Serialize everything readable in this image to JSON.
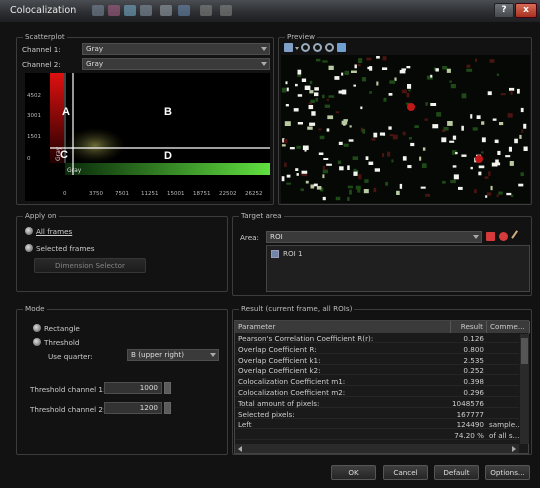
{
  "window": {
    "title": "Colocalization",
    "help_label": "?",
    "close_label": "x"
  },
  "scatterplot": {
    "group_label": "Scatterplot",
    "channel1_label": "Channel 1:",
    "channel1_value": "Gray",
    "channel2_label": "Channel 2:",
    "channel2_value": "Gray",
    "y_ticks": [
      "4502",
      "3001",
      "1501",
      "0"
    ],
    "x_ticks": [
      "0",
      "3750",
      "7501",
      "11251",
      "15001",
      "18751",
      "22502",
      "26252"
    ],
    "y_channel_label": "Gray",
    "x_channel_label": "Gray",
    "quadrants": {
      "a": "A",
      "b": "B",
      "c": "C",
      "d": "D"
    }
  },
  "preview": {
    "group_label": "Preview"
  },
  "apply_on": {
    "group_label": "Apply on",
    "all_frames": "All frames",
    "selected_frames": "Selected frames",
    "dimension_selector": "Dimension Selector"
  },
  "target_area": {
    "group_label": "Target area",
    "area_label": "Area:",
    "area_value": "ROI",
    "roi_item": "ROI 1"
  },
  "mode": {
    "group_label": "Mode",
    "rectangle": "Rectangle",
    "threshold": "Threshold",
    "use_quarter_label": "Use quarter:",
    "use_quarter_value": "B (upper right)",
    "threshold1_label": "Threshold channel 1:",
    "threshold1_value": "1000",
    "threshold2_label": "Threshold channel 2:",
    "threshold2_value": "1200"
  },
  "result": {
    "group_label": "Result (current frame, all ROIs)",
    "columns": [
      "Parameter",
      "Result",
      "Comme..."
    ],
    "rows": [
      {
        "parameter": "Pearson's Correlation Coefficient R(r):",
        "result": "0.126",
        "comment": ""
      },
      {
        "parameter": "Overlap Coefficient R:",
        "result": "0.800",
        "comment": ""
      },
      {
        "parameter": "Overlap Coefficient k1:",
        "result": "2.535",
        "comment": ""
      },
      {
        "parameter": "Overlap Coefficient k2:",
        "result": "0.252",
        "comment": ""
      },
      {
        "parameter": "Colocalization Coefficient m1:",
        "result": "0.398",
        "comment": ""
      },
      {
        "parameter": "Colocalization Coefficient m2:",
        "result": "0.296",
        "comment": ""
      },
      {
        "parameter": "Total amount of pixels:",
        "result": "1048576",
        "comment": ""
      },
      {
        "parameter": "Selected pixels:",
        "result": "167777",
        "comment": ""
      },
      {
        "parameter": "Left",
        "result": "124490",
        "comment": "sample..."
      },
      {
        "parameter": "",
        "result": "74.20 %",
        "comment": "of all s..."
      }
    ]
  },
  "buttons": {
    "ok": "OK",
    "cancel": "Cancel",
    "default": "Default",
    "options": "Options..."
  }
}
